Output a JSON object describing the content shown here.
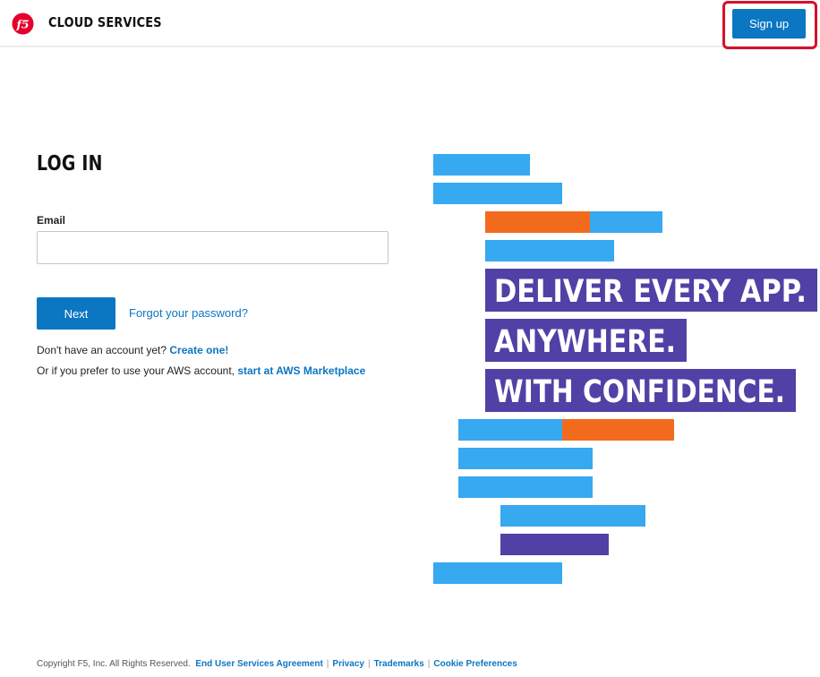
{
  "header": {
    "brand": "CLOUD SERVICES",
    "signup_label": "Sign up",
    "logo_icon": "f5-logo-icon"
  },
  "login": {
    "title": "LOG IN",
    "email_label": "Email",
    "email_value": "",
    "email_placeholder": "",
    "next_label": "Next",
    "forgot_label": "Forgot your password?",
    "no_account_text": "Don't have an account yet? ",
    "create_label": "Create one!",
    "aws_text": "Or if you prefer to use your AWS account, ",
    "aws_link": "start at AWS Marketplace"
  },
  "hero": {
    "line1": "DELIVER EVERY APP.",
    "line2": "ANYWHERE.",
    "line3": "WITH CONFIDENCE."
  },
  "footer": {
    "copyright": "Copyright F5, Inc. All Rights Reserved.",
    "links": [
      "End User Services Agreement",
      "Privacy",
      "Trademarks",
      "Cookie Preferences"
    ],
    "separator": "|"
  },
  "colors": {
    "accent_blue": "#0b76c2",
    "bar_blue": "#36a9f1",
    "bar_orange": "#f26b1d",
    "bar_purple": "#5141a6",
    "highlight_red": "#d6102a",
    "logo_red": "#e4002b"
  }
}
